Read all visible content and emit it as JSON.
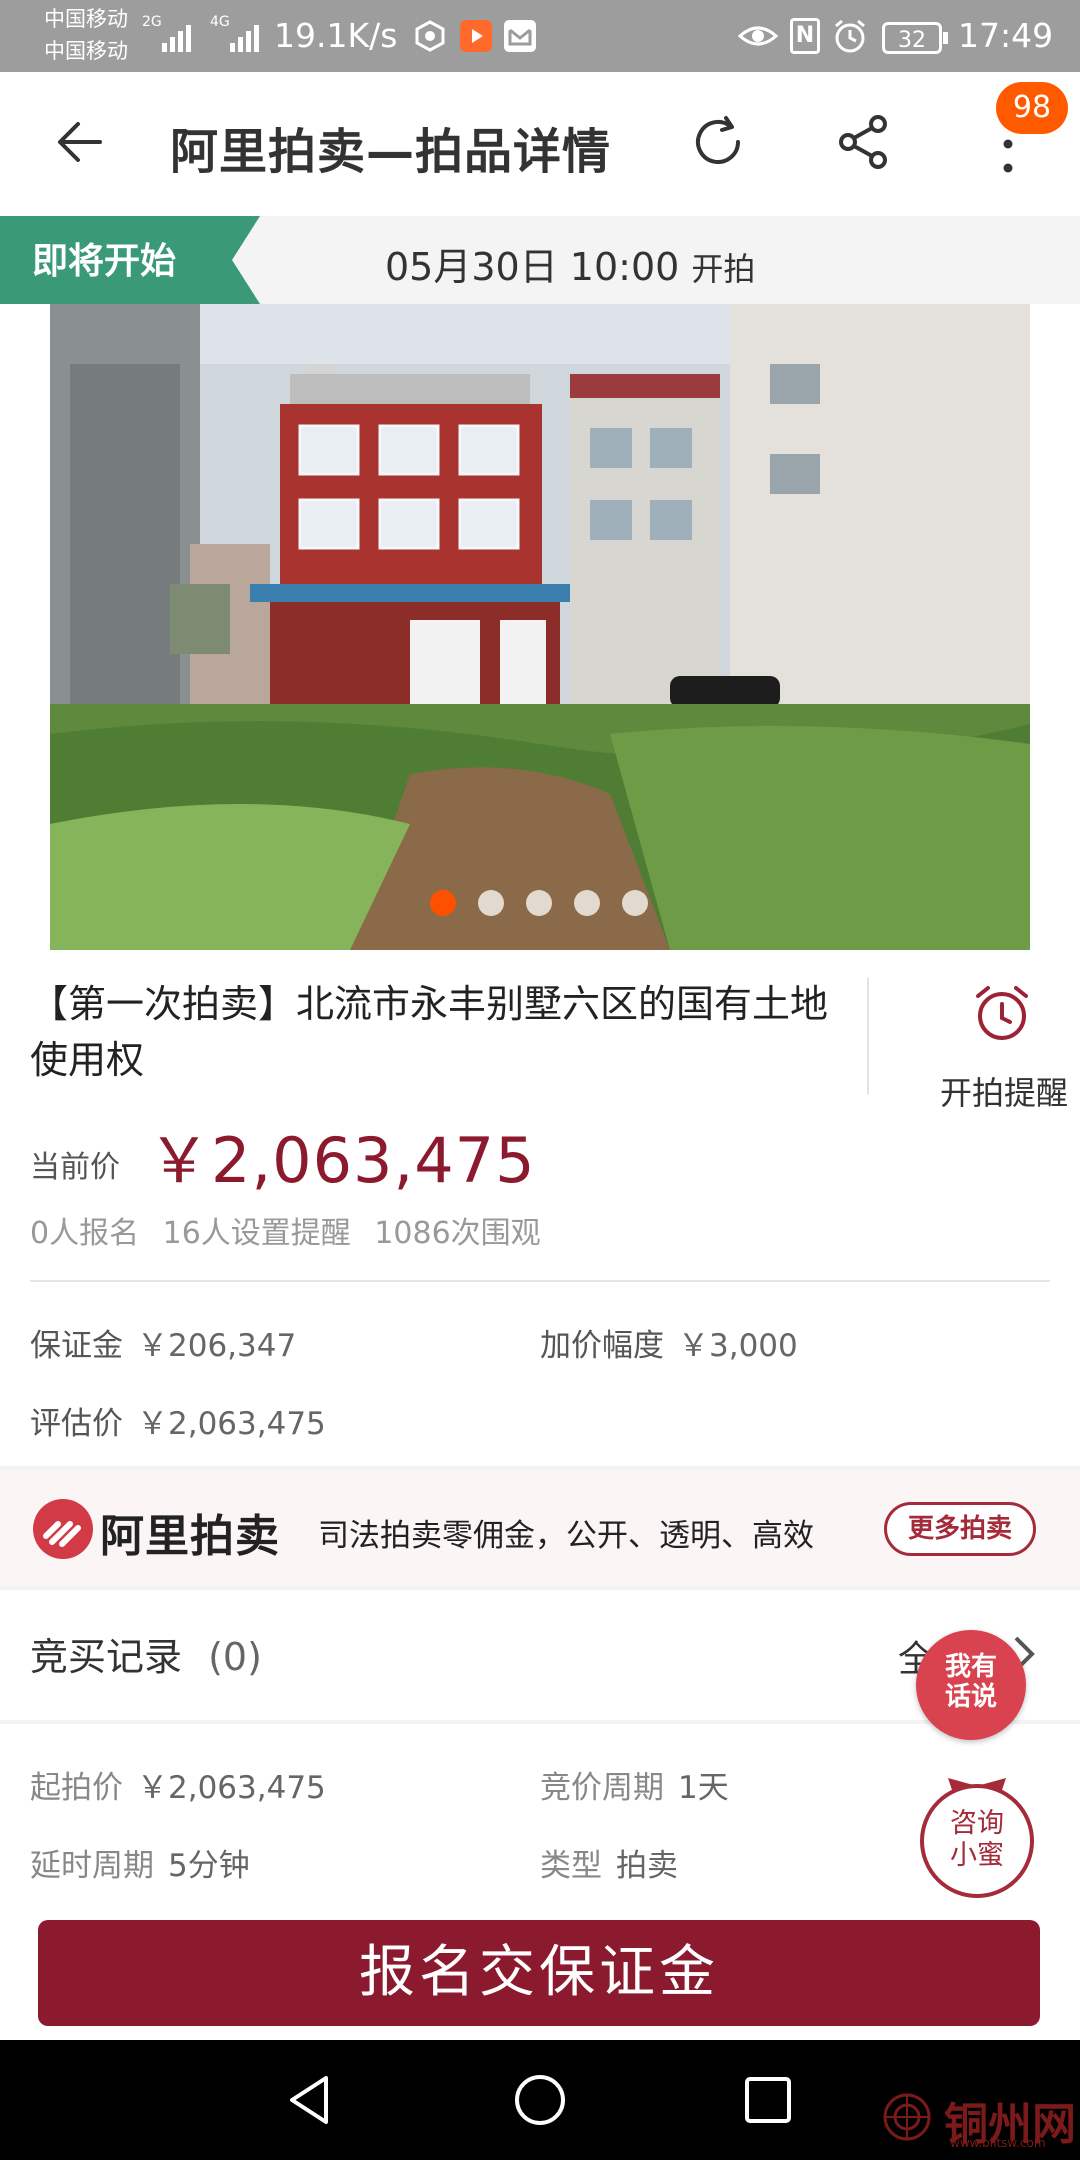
{
  "status_bar": {
    "carrier_1": "中国移动",
    "carrier_2": "中国移动",
    "net_2g": "2G",
    "net_4g": "4G",
    "speed": "19.1K/s",
    "battery": "32",
    "time": "17:49"
  },
  "nav": {
    "title": "阿里拍卖—拍品详情",
    "badge_count": "98"
  },
  "auction_status": {
    "badge": "即将开始",
    "start_time": "05月30日 10:00",
    "start_suffix": "开拍"
  },
  "gallery": {
    "image_count": 5,
    "active_index": 0
  },
  "item": {
    "title": "【第一次拍卖】北流市永丰别墅六区的国有土地使用权",
    "remind_label": "开拍提醒",
    "price_label": "当前价",
    "price": "￥2,063,475",
    "stats": "0人报名  16人设置提醒  1086次围观"
  },
  "details_1": {
    "deposit_label": "保证金",
    "deposit_value": "￥206,347",
    "increment_label": "加价幅度",
    "increment_value": "￥3,000",
    "appraisal_label": "评估价",
    "appraisal_value": "￥2,063,475"
  },
  "banner": {
    "logo_text": "阿里拍卖",
    "slogan": "司法拍卖零佣金，公开、透明、高效",
    "more_button": "更多拍卖"
  },
  "records": {
    "label": "竞买记录",
    "count": "(0)",
    "all_partial": "全"
  },
  "floating": {
    "talk_line1": "我有",
    "talk_line2": "话说",
    "consult_line1": "咨询",
    "consult_line2": "小蜜"
  },
  "details_2": {
    "start_price_label": "起拍价",
    "start_price_value": "￥2,063,475",
    "cycle_label": "竞价周期",
    "cycle_value": "1天",
    "delay_label": "延时周期",
    "delay_value": "5分钟",
    "type_label": "类型",
    "type_value": "拍卖"
  },
  "cta": {
    "label": "报名交保证金"
  },
  "watermark": {
    "text": "铜州网",
    "sub": "www.blltsw.com"
  },
  "colors": {
    "brand_red": "#8b1a2e",
    "accent_orange": "#ff5000",
    "status_green": "#3a9a78"
  }
}
